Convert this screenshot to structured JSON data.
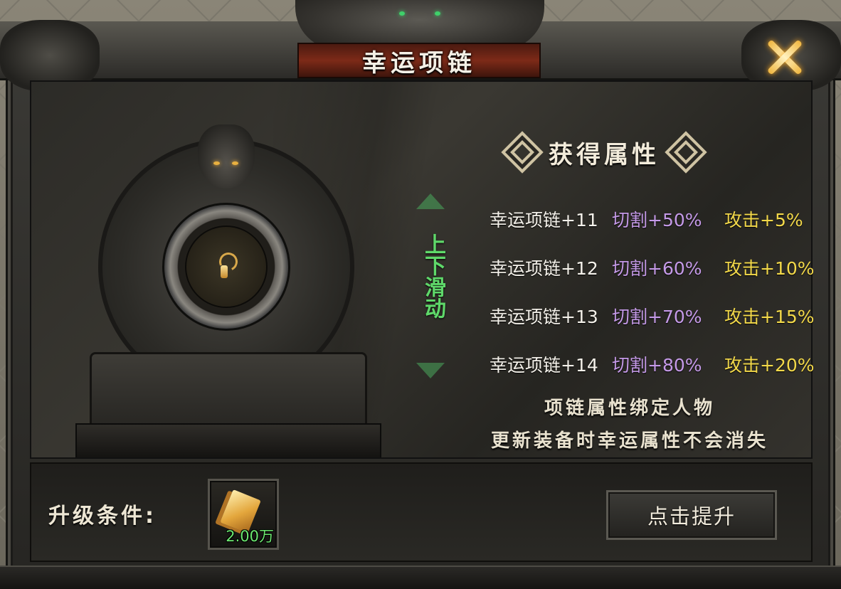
{
  "window": {
    "title": "幸运项链"
  },
  "attributes": {
    "header": "获得属性",
    "rows": [
      {
        "level": "幸运项链+11",
        "cut": "切割+50%",
        "attack": "攻击+5%"
      },
      {
        "level": "幸运项链+12",
        "cut": "切割+60%",
        "attack": "攻击+10%"
      },
      {
        "level": "幸运项链+13",
        "cut": "切割+70%",
        "attack": "攻击+15%"
      },
      {
        "level": "幸运项链+14",
        "cut": "切割+80%",
        "attack": "攻击+20%"
      }
    ],
    "scroll_hint": "上下滑动"
  },
  "notes": {
    "line1": "项链属性绑定人物",
    "line2": "更新装备时幸运属性不会消失"
  },
  "upgrade": {
    "condition_label": "升级条件:",
    "item_count": "2.00万",
    "button_label": "点击提升"
  },
  "colors": {
    "cut": "#c59ae8",
    "attack": "#f3d94a",
    "scroll_hint": "#5fd86a",
    "item_count": "#6ce870"
  }
}
